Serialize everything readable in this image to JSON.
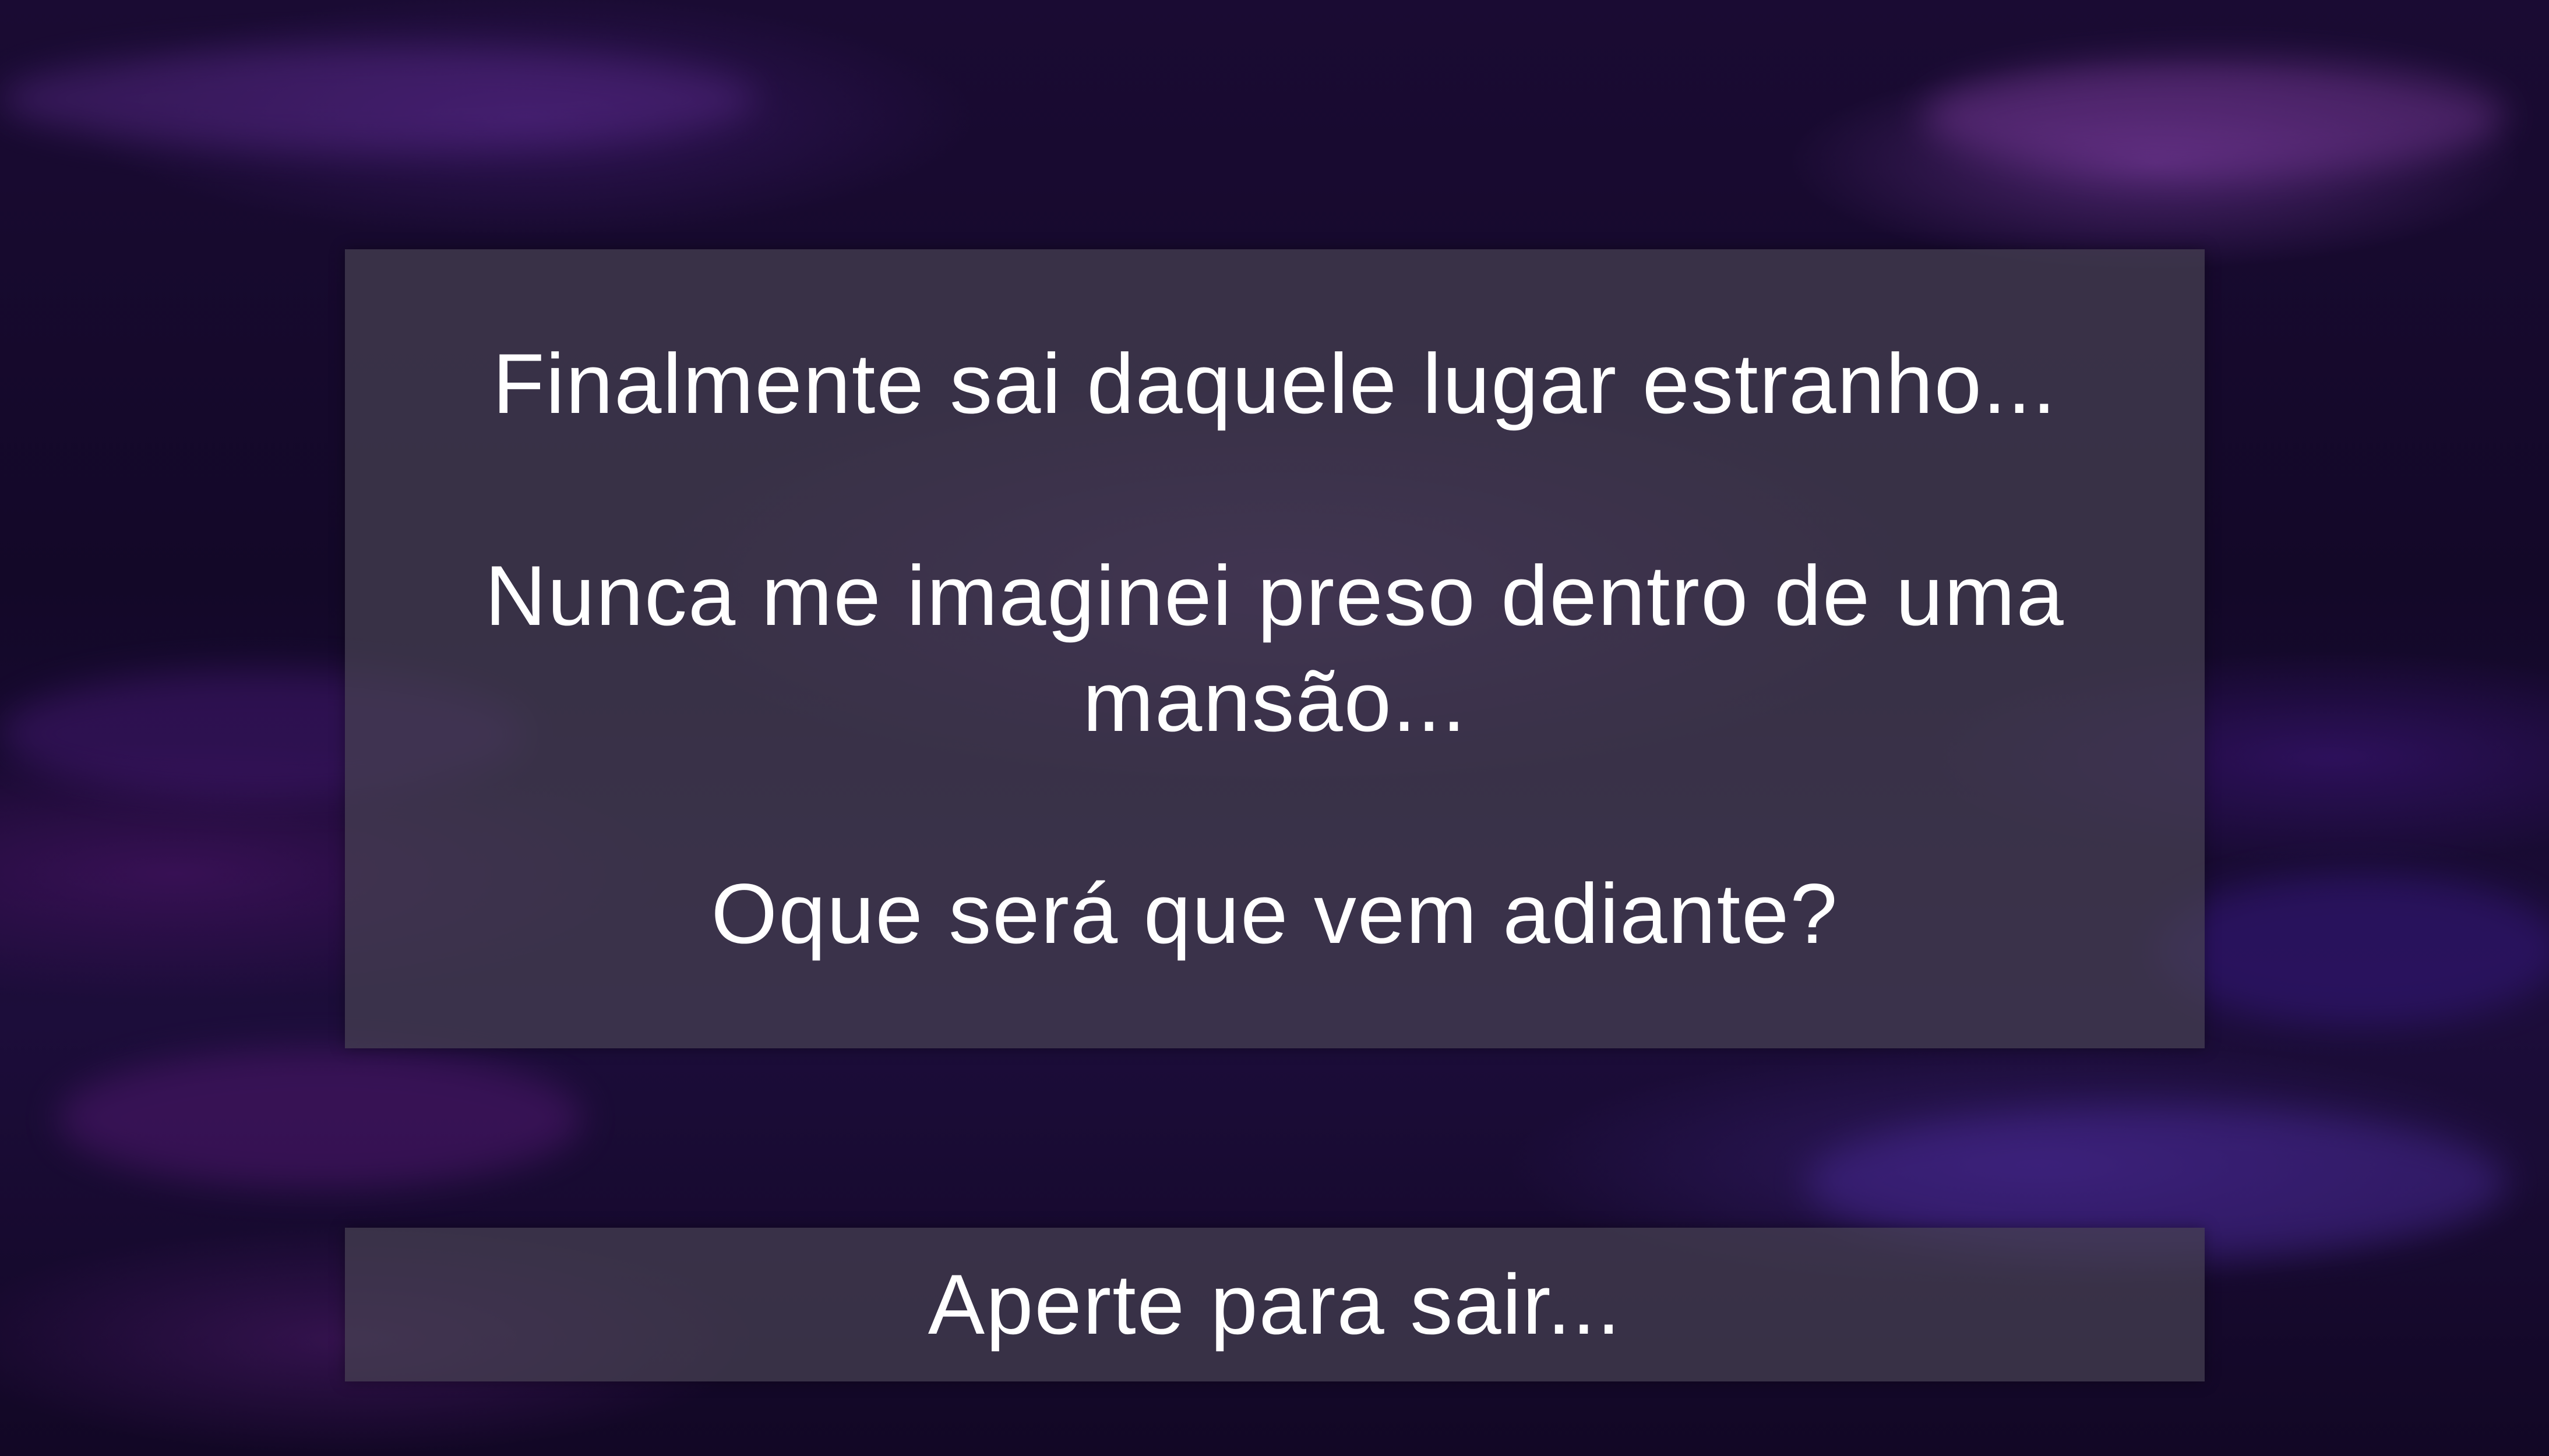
{
  "dialog": {
    "line1": "Finalmente sai daquele lugar estranho...",
    "line2": "Nunca me imaginei preso dentro de uma mansão...",
    "line3": "Oque será que vem adiante?"
  },
  "exit_button": {
    "label": "Aperte para sair..."
  },
  "colors": {
    "background": "#1a0b33",
    "panel": "#46415280",
    "text": "#ffffff"
  }
}
